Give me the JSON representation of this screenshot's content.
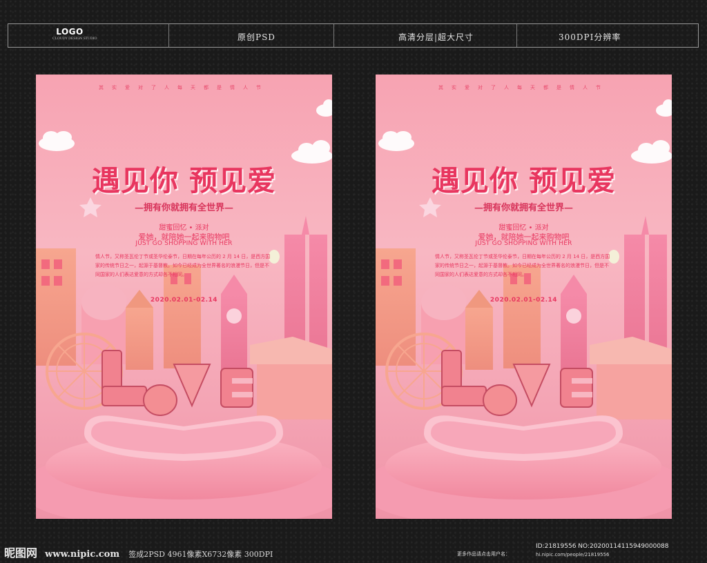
{
  "header": {
    "logo": "LOGO",
    "logo_sub": "CLOUDY DESIGN STUDIO",
    "item1": "原创PSD",
    "item2": "高清分层|超大尺寸",
    "item3": "300DPI分辨率"
  },
  "poster": {
    "tagline": "其实爱对了人每天都是情人节",
    "title": "遇见你 预见爱",
    "subtitle": "—拥有你就拥有全世界—",
    "theme": "甜蜜回忆 • 派对",
    "slogan": "爱她，就陪她一起来购物吧",
    "english": "JUST GO SHOPPING WITH HER",
    "body": "情人节，又称圣瓦伦丁节或圣华伦泰节，日期在每年公历的 2 月 14 日，是西方国家的传统节日之一，起源于基督教。如今已经成为全世界著名的浪漫节日，但是不同国家的人们表达爱意的方式却各不相同。",
    "date": "2020.02.01-02.14",
    "love": "LOVE"
  },
  "footer": {
    "brand": "昵图网",
    "site": "www.nipic.com",
    "meta": "签成2PSD  4961像素X6732像素  300DPI",
    "more": "更多作品请点击用户名：",
    "id": "ID:21819556 NO:20200114115949000088",
    "url": "hi.nipic.com/people/21819556"
  },
  "colors": {
    "accent": "#e8365f",
    "poster_bg": "#f8b7c2",
    "page_bg": "#1a1a1a"
  }
}
